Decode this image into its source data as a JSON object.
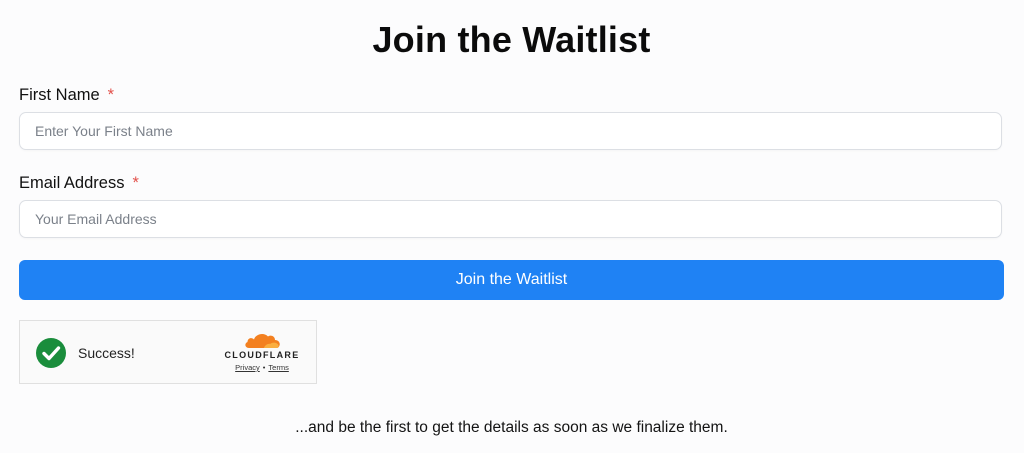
{
  "form": {
    "title": "Join the Waitlist",
    "first_name": {
      "label": "First Name",
      "required_marker": "*",
      "placeholder": "Enter Your First Name",
      "value": ""
    },
    "email": {
      "label": "Email Address",
      "required_marker": "*",
      "placeholder": "Your Email Address",
      "value": ""
    },
    "submit_label": "Join the Waitlist"
  },
  "turnstile": {
    "status": "Success!",
    "brand": "CLOUDFLARE",
    "privacy_link": "Privacy",
    "separator": "•",
    "terms_link": "Terms",
    "check_color": "#1a8d3c",
    "cloud_color": "#f38020"
  },
  "footer": {
    "note": "...and be the first to get the details as soon as we finalize them."
  },
  "colors": {
    "accent": "#1f82f4",
    "required": "#e2504a"
  }
}
